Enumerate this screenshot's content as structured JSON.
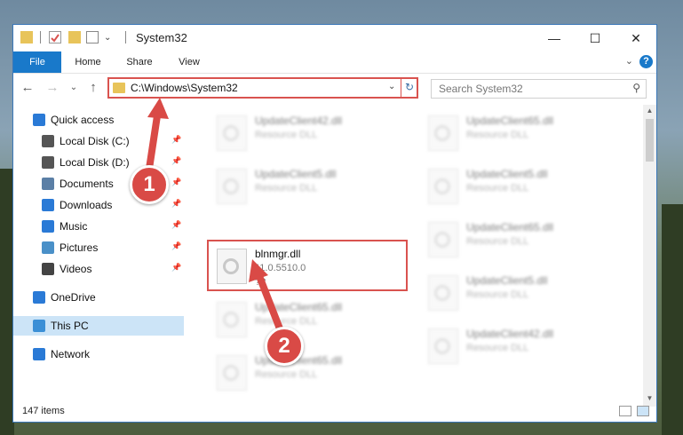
{
  "window": {
    "title": "System32",
    "minimize_glyph": "—",
    "maximize_glyph": "☐",
    "close_glyph": "✕"
  },
  "ribbon": {
    "tabs": [
      "File",
      "Home",
      "Share",
      "View"
    ],
    "help_glyph": "?",
    "expand_glyph": "⌄"
  },
  "nav": {
    "back_glyph": "←",
    "forward_glyph": "→",
    "recent_glyph": "⌄",
    "up_glyph": "↑",
    "address": "C:\\Windows\\System32",
    "address_dropdown_glyph": "⌄",
    "refresh_glyph": "↻",
    "search_placeholder": "Search System32",
    "search_glyph": "⚲"
  },
  "sidebar": {
    "items": [
      {
        "label": "Quick access",
        "icon": "star-icon",
        "pinned": false,
        "selected": false
      },
      {
        "label": "Local Disk (C:)",
        "icon": "drive-icon",
        "pinned": true,
        "selected": false
      },
      {
        "label": "Local Disk (D:)",
        "icon": "drive-icon",
        "pinned": true,
        "selected": false
      },
      {
        "label": "Documents",
        "icon": "documents-icon",
        "pinned": true,
        "selected": false
      },
      {
        "label": "Downloads",
        "icon": "downloads-icon",
        "pinned": true,
        "selected": false
      },
      {
        "label": "Music",
        "icon": "music-icon",
        "pinned": true,
        "selected": false
      },
      {
        "label": "Pictures",
        "icon": "pictures-icon",
        "pinned": true,
        "selected": false
      },
      {
        "label": "Videos",
        "icon": "videos-icon",
        "pinned": true,
        "selected": false
      },
      {
        "label": "OneDrive",
        "icon": "cloud-icon",
        "pinned": false,
        "selected": false
      },
      {
        "label": "This PC",
        "icon": "computer-icon",
        "pinned": false,
        "selected": true
      },
      {
        "label": "Network",
        "icon": "network-icon",
        "pinned": false,
        "selected": false
      }
    ],
    "pin_glyph": "📌"
  },
  "files": {
    "left": [
      {
        "name": "UpdateClient42.dll",
        "desc": "Resource DLL",
        "extra": "",
        "blurred": true
      },
      {
        "name": "UpdateClient5.dll",
        "desc": "Resource DLL",
        "extra": "",
        "blurred": true
      },
      {
        "name": "blnmgr.dll",
        "desc": "11.0.5510.0",
        "extra": "??",
        "blurred": false
      },
      {
        "name": "UpdateClient65.dll",
        "desc": "Resource DLL",
        "extra": "",
        "blurred": true
      },
      {
        "name": "UpdateClient65.dll",
        "desc": "Resource DLL",
        "extra": "",
        "blurred": true
      }
    ],
    "right": [
      {
        "name": "UpdateClient65.dll",
        "desc": "Resource DLL",
        "extra": "",
        "blurred": true
      },
      {
        "name": "UpdateClient5.dll",
        "desc": "Resource DLL",
        "extra": "",
        "blurred": true
      },
      {
        "name": "UpdateClient65.dll",
        "desc": "Resource DLL",
        "extra": "",
        "blurred": true
      },
      {
        "name": "UpdateClient5.dll",
        "desc": "Resource DLL",
        "extra": "",
        "blurred": true
      },
      {
        "name": "UpdateClient42.dll",
        "desc": "Resource DLL",
        "extra": "",
        "blurred": true
      }
    ]
  },
  "status": {
    "item_count": "147 items"
  },
  "callouts": {
    "one": "1",
    "two": "2"
  },
  "colors": {
    "accent": "#1979ca",
    "highlight": "#d9534f",
    "selected": "#cce4f7"
  }
}
